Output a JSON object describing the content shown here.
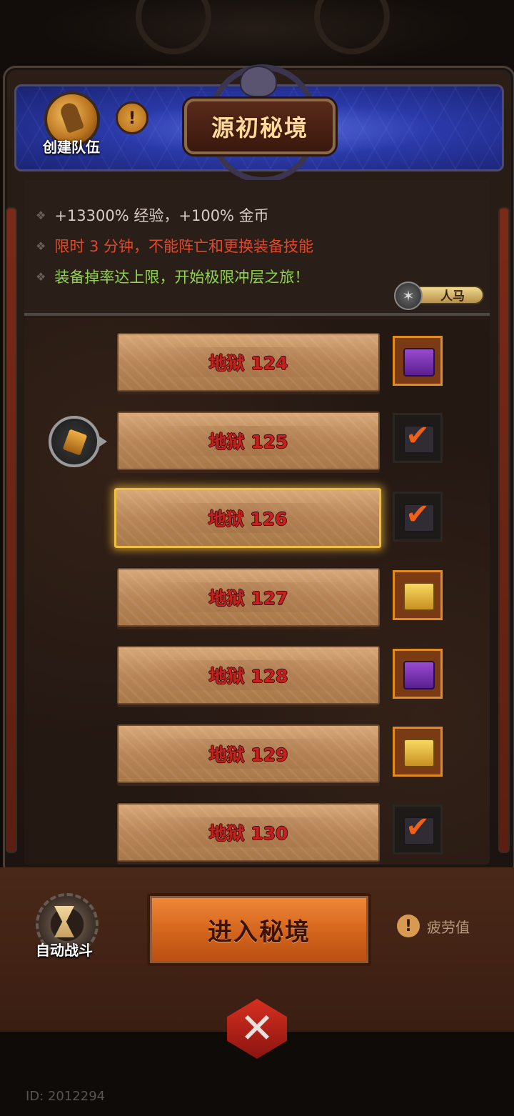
{
  "header": {
    "title": "源初秘境",
    "team_button_label": "创建队伍",
    "info_symbol": "!"
  },
  "info": {
    "lines": [
      "+13300% 经验，+100% 金币",
      "限时 3 分钟，不能阵亡和更换装备技能",
      "装备掉率达上限，开始极限冲层之旅！"
    ],
    "line_colors": [
      "#d8ccc4",
      "#e0482e",
      "#8ed44a"
    ],
    "mount_tag": "人马"
  },
  "levels": [
    {
      "label": "地狱 124",
      "chest": "purple",
      "claimed": false,
      "selected": false
    },
    {
      "label": "地狱 125",
      "chest": "dark",
      "claimed": true,
      "selected": false
    },
    {
      "label": "地狱 126",
      "chest": "dark",
      "claimed": true,
      "selected": true
    },
    {
      "label": "地狱 127",
      "chest": "gold",
      "claimed": false,
      "selected": false
    },
    {
      "label": "地狱 128",
      "chest": "purple",
      "claimed": false,
      "selected": false
    },
    {
      "label": "地狱 129",
      "chest": "gold",
      "claimed": false,
      "selected": false
    },
    {
      "label": "地狱 130",
      "chest": "dark",
      "claimed": true,
      "selected": false
    }
  ],
  "check_symbol": "✔",
  "bottom": {
    "auto_battle_label": "自动战斗",
    "enter_button_label": "进入秘境",
    "fatigue_label": "疲劳值",
    "fatigue_symbol": "!",
    "close_symbol": "✕"
  },
  "footer": {
    "id_text": "ID: 2012294"
  },
  "colors": {
    "accent_orange": "#d86a20",
    "level_text": "#c8201e",
    "banner_blue": "#2a39a8"
  }
}
